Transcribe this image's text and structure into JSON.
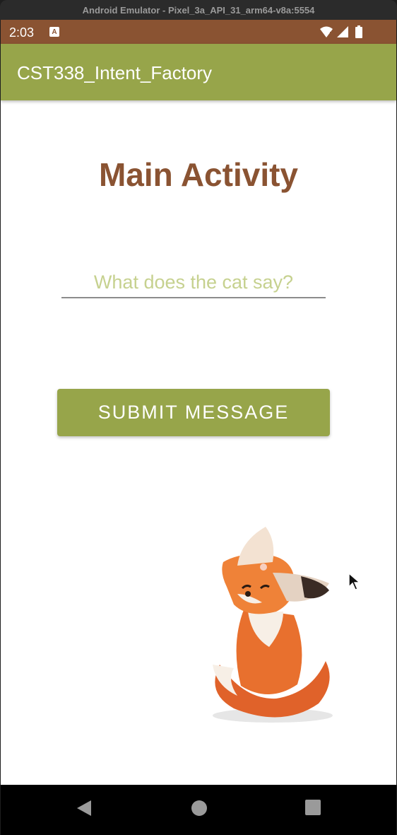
{
  "window": {
    "title": "Android Emulator - Pixel_3a_API_31_arm64-v8a:5554"
  },
  "status_bar": {
    "time": "2:03",
    "notification_badge": "A"
  },
  "app_bar": {
    "title": "CST338_Intent_Factory"
  },
  "main": {
    "heading": "Main Activity",
    "input_placeholder": "What does the cat say?",
    "input_value": "",
    "submit_label": "SUBMIT MESSAGE"
  },
  "colors": {
    "status_bar": "#8a5332",
    "app_bar": "#97a54a",
    "heading": "#8a5332",
    "placeholder": "#c6d18f"
  },
  "icons": [
    "wifi-icon",
    "signal-icon",
    "battery-icon",
    "back-icon",
    "home-icon",
    "recents-icon",
    "fox-illustration",
    "mouse-cursor-icon"
  ]
}
